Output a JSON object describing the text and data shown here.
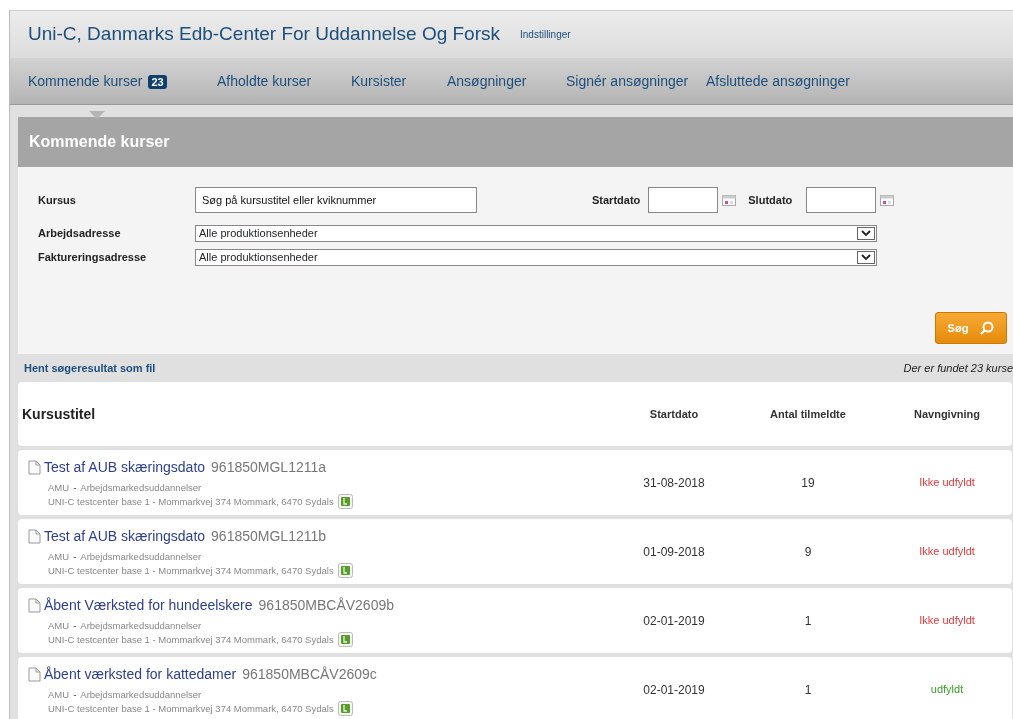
{
  "header": {
    "title": "Uni-C, Danmarks Edb-Center For Uddannelse Og Forsk",
    "settings_link": "Indstillinger"
  },
  "tabs": [
    {
      "label": "Kommende kurser",
      "badge": "23",
      "selected": true
    },
    {
      "label": "Afholdte kurser",
      "selected": false
    },
    {
      "label": "Kursister",
      "selected": false
    },
    {
      "label": "Ansøgninger",
      "selected": false
    },
    {
      "label": "Signér ansøgninger",
      "selected": false
    },
    {
      "label": "Afsluttede ansøgninger",
      "selected": false
    }
  ],
  "panel": {
    "title": "Kommende kurser"
  },
  "filters": {
    "course_label": "Kursus",
    "course_value": "Søg på kursustitel eller kviknummer",
    "start_label": "Startdato",
    "end_label": "Slutdato",
    "selects": [
      {
        "label": "Arbejdsadresse",
        "value": "Alle produktionsenheder"
      },
      {
        "label": "Faktureringsadresse",
        "value": "Alle produktionsenheder"
      }
    ],
    "search_button": "Søg"
  },
  "result_bar": {
    "download_link": "Hent søgeresultat som fil",
    "count": "Der er fundet 23 kurse"
  },
  "table": {
    "columns": [
      "Kursustitel",
      "Startdato",
      "Antal tilmeldte",
      "Navngivning"
    ],
    "rows": [
      {
        "title": "Test af AUB skæringsdato",
        "code": "961850MGL1211a",
        "type": "AMU",
        "separator": "-",
        "type_desc": "Arbejdsmarkedsuddannelser",
        "address": "UNI-C testcenter base 1 - Mommarkvej 374 Mommark, 6470 Sydals",
        "start": "31-08-2018",
        "count": "19",
        "naming": "Ikke udfyldt",
        "filled": false
      },
      {
        "title": "Test af AUB skæringsdato",
        "code": "961850MGL1211b",
        "type": "AMU",
        "separator": "-",
        "type_desc": "Arbejdsmarkedsuddannelser",
        "address": "UNI-C testcenter base 1 - Mommarkvej 374 Mommark, 6470 Sydals",
        "start": "01-09-2018",
        "count": "9",
        "naming": "Ikke udfyldt",
        "filled": false
      },
      {
        "title": "Åbent Værksted for hundeelskere",
        "code": "961850MBCÅV2609b",
        "type": "AMU",
        "separator": "-",
        "type_desc": "Arbejdsmarkedsuddannelser",
        "address": "UNI-C testcenter base 1 - Mommarkvej 374 Mommark, 6470 Sydals",
        "start": "02-01-2019",
        "count": "1",
        "naming": "Ikke udfyldt",
        "filled": false
      },
      {
        "title": "Åbent værksted for kattedamer",
        "code": "961850MBCÅV2609c",
        "type": "AMU",
        "separator": "-",
        "type_desc": "Arbejdsmarkedsuddannelser",
        "address": "UNI-C testcenter base 1 - Mommarkvej 374 Mommark, 6470 Sydals",
        "start": "02-01-2019",
        "count": "1",
        "naming": "udfyldt",
        "filled": true
      }
    ]
  }
}
